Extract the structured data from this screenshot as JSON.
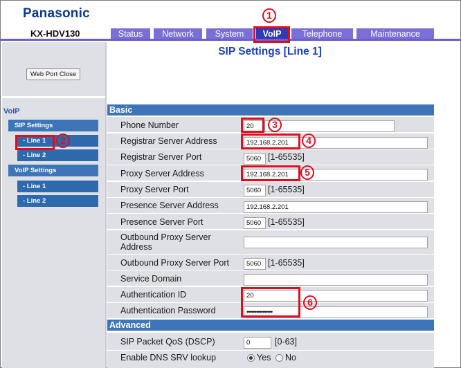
{
  "header": {
    "brand": "Panasonic",
    "model": "KX-HDV130",
    "tabs": [
      {
        "label": "Status"
      },
      {
        "label": "Network"
      },
      {
        "label": "System"
      },
      {
        "label": "VoIP"
      },
      {
        "label": "Telephone"
      },
      {
        "label": "Maintenance"
      }
    ],
    "active_tab": "VoIP"
  },
  "sidebar": {
    "web_port_close_label": "Web Port Close",
    "section_label": "VoIP",
    "menu": [
      {
        "label": "SIP Settings"
      },
      {
        "label": "- Line 1"
      },
      {
        "label": "- Line 2"
      },
      {
        "label": "VoIP Settings"
      },
      {
        "label": "- Line 1"
      },
      {
        "label": "- Line 2"
      }
    ]
  },
  "main": {
    "title": "SIP Settings [Line 1]",
    "basic_section": "Basic",
    "advanced_section": "Advanced",
    "fields": {
      "phone_number": {
        "label": "Phone Number",
        "value": "20"
      },
      "registrar_address": {
        "label": "Registrar Server Address",
        "value": "192.168.2.201"
      },
      "registrar_port": {
        "label": "Registrar Server Port",
        "value": "5060",
        "range": "[1-65535]"
      },
      "proxy_address": {
        "label": "Proxy Server Address",
        "value": "192.168.2.201"
      },
      "proxy_port": {
        "label": "Proxy Server Port",
        "value": "5060",
        "range": "[1-65535]"
      },
      "presence_address": {
        "label": "Presence Server Address",
        "value": "192.168.2.201"
      },
      "presence_port": {
        "label": "Presence Server Port",
        "value": "5060",
        "range": "[1-65535]"
      },
      "outbound_proxy_address": {
        "label": "Outbound Proxy Server Address",
        "value": ""
      },
      "outbound_proxy_port": {
        "label": "Outbound Proxy Server Port",
        "value": "5060",
        "range": "[1-65535]"
      },
      "service_domain": {
        "label": "Service Domain",
        "value": ""
      },
      "auth_id": {
        "label": "Authentication ID",
        "value": "20"
      },
      "auth_password": {
        "label": "Authentication Password",
        "value": "••••••••••••••••"
      },
      "sip_qos": {
        "label": "SIP Packet QoS (DSCP)",
        "value": "0",
        "range": "[0-63]"
      },
      "dns_srv": {
        "label": "Enable DNS SRV lookup",
        "yes": "Yes",
        "no": "No",
        "selected": "Yes"
      }
    }
  },
  "annotations": {
    "c1": "1",
    "c2": "2",
    "c3": "3",
    "c4": "4",
    "c5": "5",
    "c6": "6",
    "highlight_color": "#e30b1c"
  },
  "colors": {
    "brand": "#0e3a8c",
    "tab": "#7a6fd6",
    "tab_active": "#2e3ab8",
    "section_bar": "#3d75b8",
    "title": "#1a3ec7"
  }
}
